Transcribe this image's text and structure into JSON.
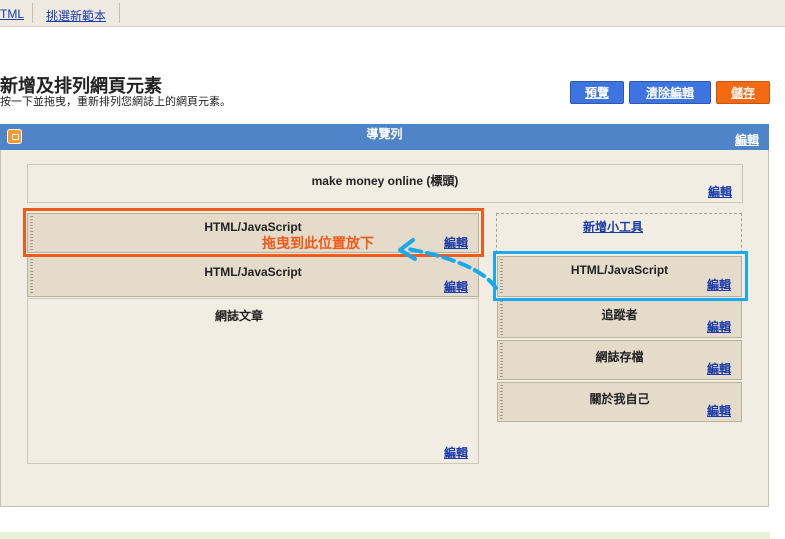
{
  "tabs": {
    "tab_html": "TML",
    "tab_template": "挑選新範本"
  },
  "page": {
    "title": "新增及排列網頁元素",
    "subtitle": "按一下並拖曳，重新排列您網誌上的網頁元素。"
  },
  "buttons": {
    "preview": "預覽",
    "clear_edits": "清除編輯",
    "save": "儲存"
  },
  "navbar": {
    "title": "導覽列",
    "edit": "編輯"
  },
  "header_gadget": {
    "title": "make money online (標頭)",
    "edit": "編輯"
  },
  "main_column": {
    "widgets": [
      {
        "title": "HTML/JavaScript",
        "edit": "編輯"
      },
      {
        "title": "HTML/JavaScript",
        "edit": "編輯"
      }
    ],
    "posts": {
      "title": "網誌文章",
      "edit": "編輯"
    }
  },
  "sidebar": {
    "add_gadget": "新增小工具",
    "widgets": [
      {
        "title": "HTML/JavaScript",
        "edit": "編輯"
      },
      {
        "title": "追蹤者",
        "edit": "編輯"
      },
      {
        "title": "網誌存檔",
        "edit": "編輯"
      },
      {
        "title": "關於我自己",
        "edit": "編輯"
      }
    ]
  },
  "annotation": {
    "drop_here": "拖曳到此位置放下"
  },
  "colors": {
    "accent_blue": "#3d74e0",
    "save_orange": "#f46a12",
    "navbar_blue": "#4f85c8",
    "highlight_orange": "#f05a1a",
    "highlight_blue": "#1aa8ee"
  }
}
